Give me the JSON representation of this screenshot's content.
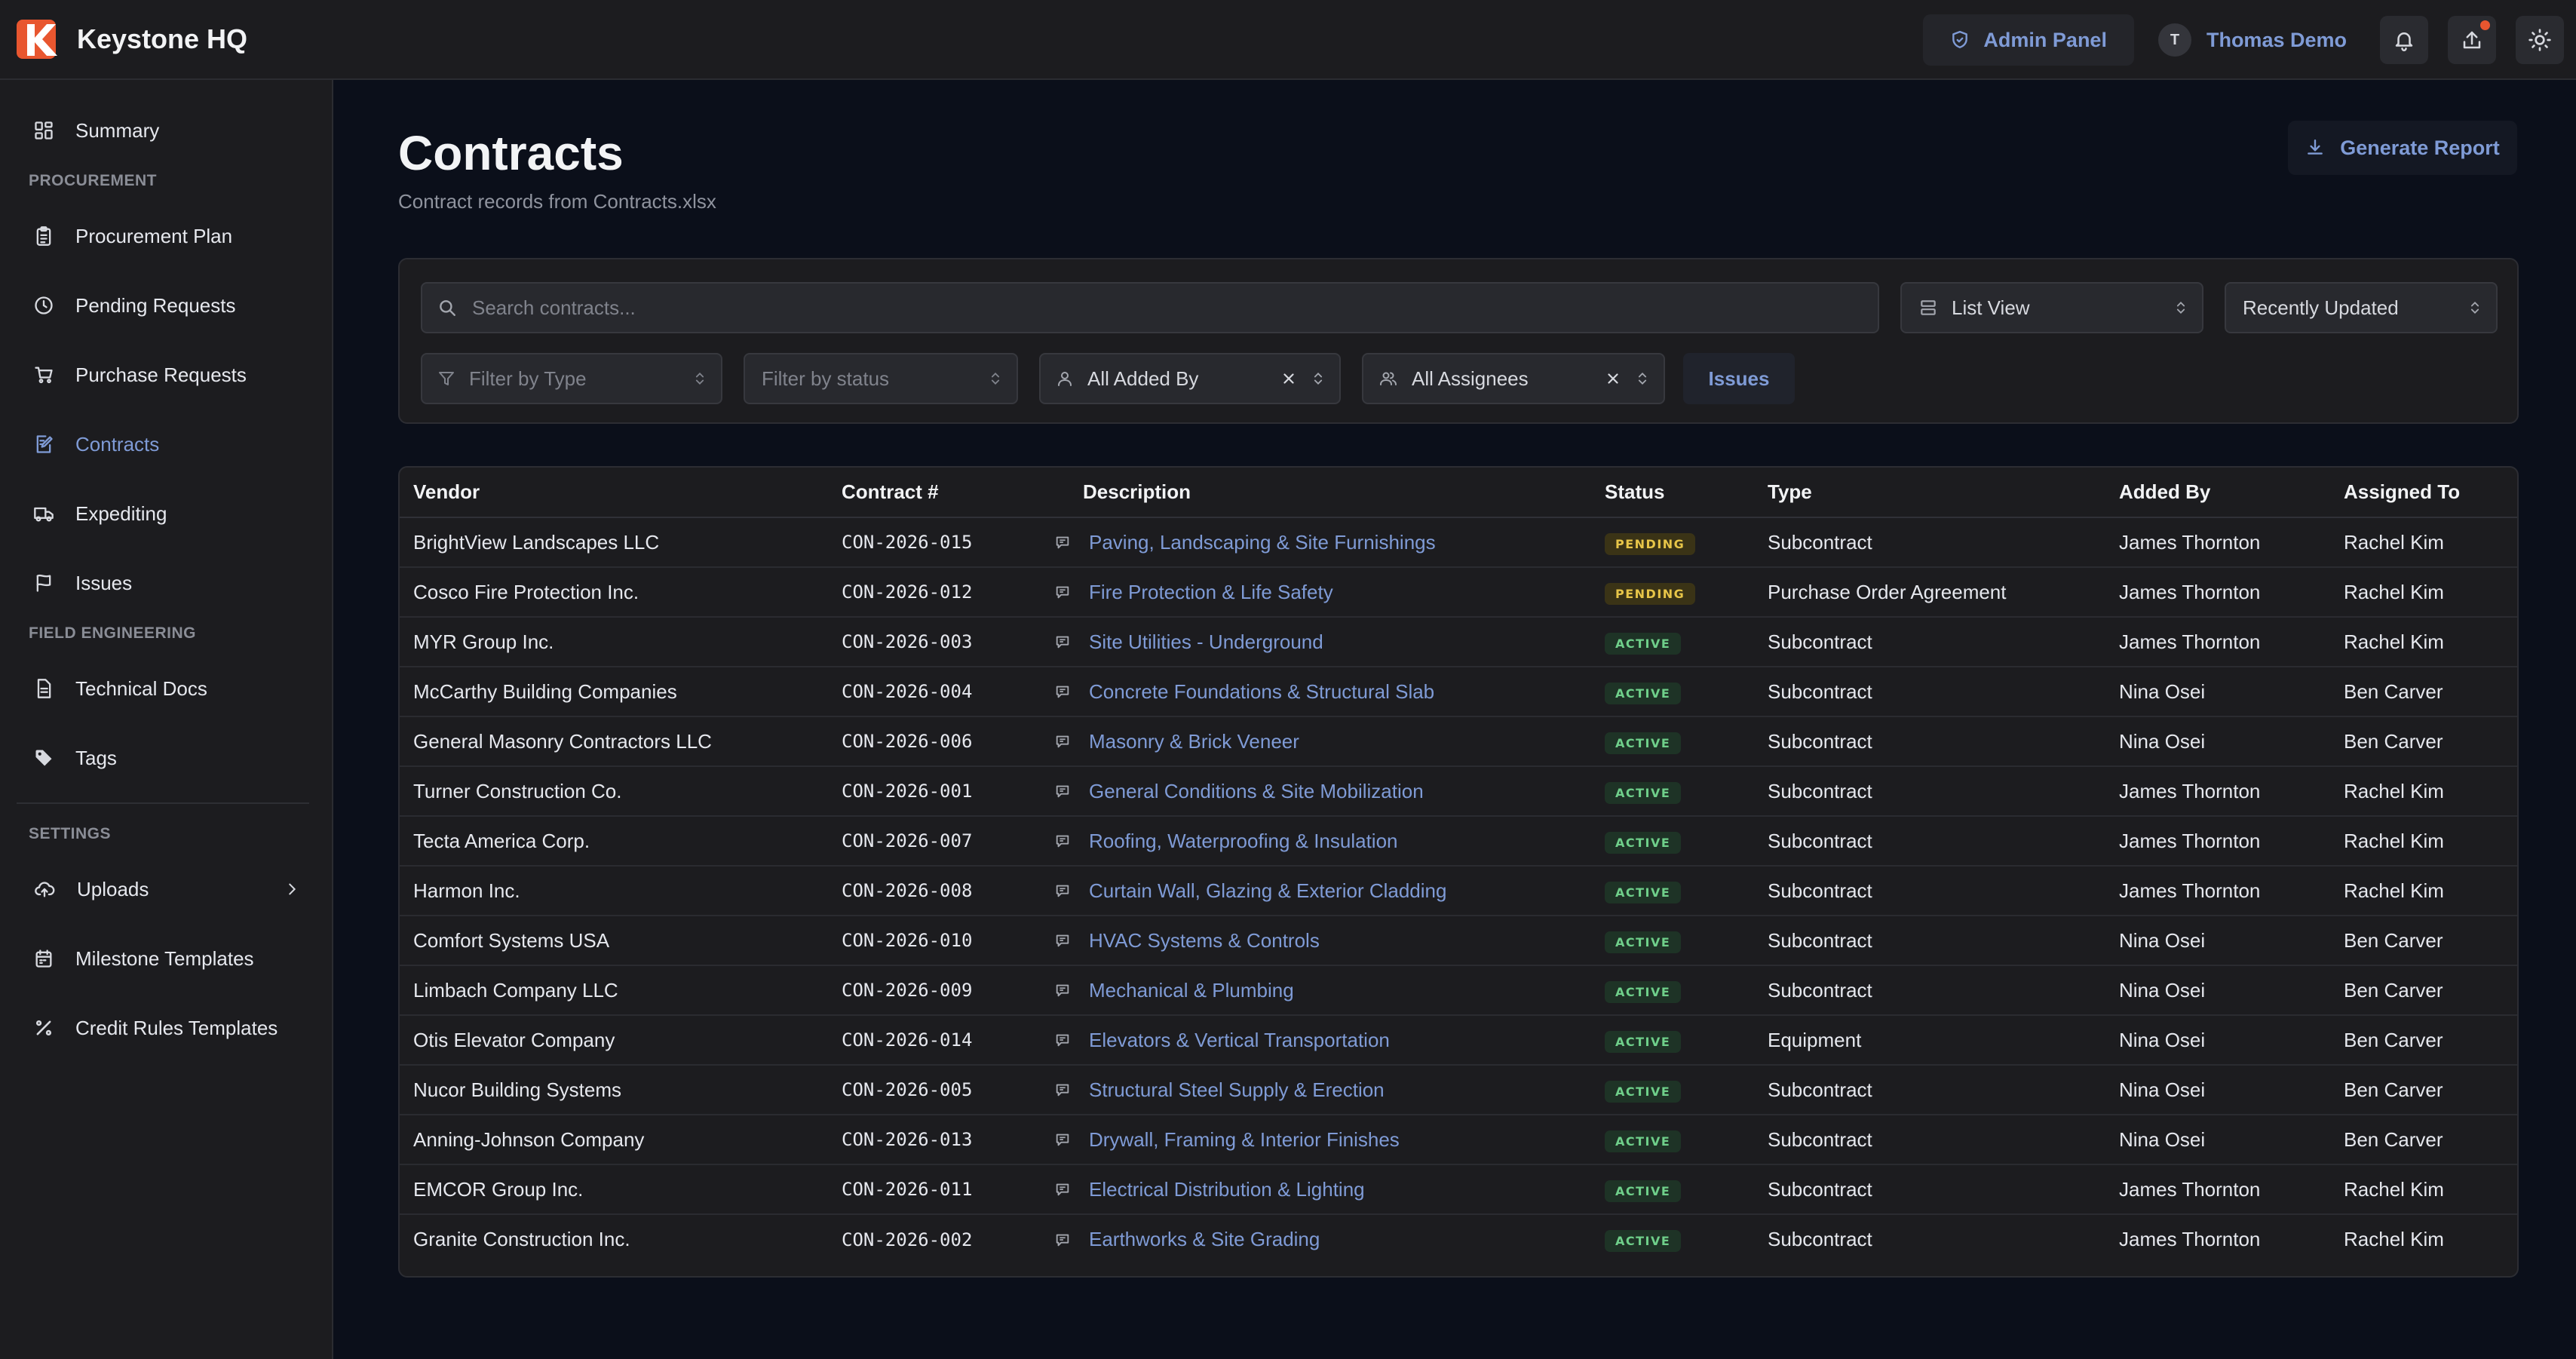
{
  "app": {
    "name": "Keystone HQ",
    "admin_panel_label": "Admin Panel",
    "user_initial": "T",
    "user_name": "Thomas Demo",
    "accent": "#7f9bd6",
    "logo_colors": [
      "#e8562f",
      "#ffffff"
    ]
  },
  "sidebar": {
    "summary": "Summary",
    "procurement_section": "PROCUREMENT",
    "procurement_plan": "Procurement Plan",
    "pending_requests": "Pending Requests",
    "purchase_requests": "Purchase Requests",
    "contracts": "Contracts",
    "expediting": "Expediting",
    "issues": "Issues",
    "field_engineering_section": "FIELD ENGINEERING",
    "technical_docs": "Technical Docs",
    "tags": "Tags",
    "settings_section": "SETTINGS",
    "uploads": "Uploads",
    "milestone_templates": "Milestone Templates",
    "credit_rules_templates": "Credit Rules Templates",
    "active_item": "Contracts"
  },
  "page": {
    "title": "Contracts",
    "subtitle": "Contract records from Contracts.xlsx",
    "generate_report": "Generate Report"
  },
  "filters": {
    "search_placeholder": "Search contracts...",
    "view_select": "List View",
    "sort_select": "Recently Updated",
    "type_placeholder": "Filter by Type",
    "status_placeholder": "Filter by status",
    "added_by": "All Added By",
    "assignees": "All Assignees",
    "issues_button": "Issues"
  },
  "table": {
    "columns": [
      "Vendor",
      "Contract #",
      "Description",
      "Status",
      "Type",
      "Added By",
      "Assigned To"
    ],
    "rows": [
      {
        "vendor": "BrightView Landscapes LLC",
        "contract": "CON-2026-015",
        "description": "Paving, Landscaping & Site Furnishings",
        "status": "PENDING",
        "type": "Subcontract",
        "added_by": "James Thornton",
        "assigned_to": "Rachel Kim"
      },
      {
        "vendor": "Cosco Fire Protection Inc.",
        "contract": "CON-2026-012",
        "description": "Fire Protection & Life Safety",
        "status": "PENDING",
        "type": "Purchase Order Agreement",
        "added_by": "James Thornton",
        "assigned_to": "Rachel Kim"
      },
      {
        "vendor": "MYR Group Inc.",
        "contract": "CON-2026-003",
        "description": "Site Utilities - Underground",
        "status": "ACTIVE",
        "type": "Subcontract",
        "added_by": "James Thornton",
        "assigned_to": "Rachel Kim"
      },
      {
        "vendor": "McCarthy Building Companies",
        "contract": "CON-2026-004",
        "description": "Concrete Foundations & Structural Slab",
        "status": "ACTIVE",
        "type": "Subcontract",
        "added_by": "Nina Osei",
        "assigned_to": "Ben Carver"
      },
      {
        "vendor": "General Masonry Contractors LLC",
        "contract": "CON-2026-006",
        "description": "Masonry & Brick Veneer",
        "status": "ACTIVE",
        "type": "Subcontract",
        "added_by": "Nina Osei",
        "assigned_to": "Ben Carver"
      },
      {
        "vendor": "Turner Construction Co.",
        "contract": "CON-2026-001",
        "description": "General Conditions & Site Mobilization",
        "status": "ACTIVE",
        "type": "Subcontract",
        "added_by": "James Thornton",
        "assigned_to": "Rachel Kim"
      },
      {
        "vendor": "Tecta America Corp.",
        "contract": "CON-2026-007",
        "description": "Roofing, Waterproofing & Insulation",
        "status": "ACTIVE",
        "type": "Subcontract",
        "added_by": "James Thornton",
        "assigned_to": "Rachel Kim"
      },
      {
        "vendor": "Harmon Inc.",
        "contract": "CON-2026-008",
        "description": "Curtain Wall, Glazing & Exterior Cladding",
        "status": "ACTIVE",
        "type": "Subcontract",
        "added_by": "James Thornton",
        "assigned_to": "Rachel Kim"
      },
      {
        "vendor": "Comfort Systems USA",
        "contract": "CON-2026-010",
        "description": "HVAC Systems & Controls",
        "status": "ACTIVE",
        "type": "Subcontract",
        "added_by": "Nina Osei",
        "assigned_to": "Ben Carver"
      },
      {
        "vendor": "Limbach Company LLC",
        "contract": "CON-2026-009",
        "description": "Mechanical & Plumbing",
        "status": "ACTIVE",
        "type": "Subcontract",
        "added_by": "Nina Osei",
        "assigned_to": "Ben Carver"
      },
      {
        "vendor": "Otis Elevator Company",
        "contract": "CON-2026-014",
        "description": "Elevators & Vertical Transportation",
        "status": "ACTIVE",
        "type": "Equipment",
        "added_by": "Nina Osei",
        "assigned_to": "Ben Carver"
      },
      {
        "vendor": "Nucor Building Systems",
        "contract": "CON-2026-005",
        "description": "Structural Steel Supply & Erection",
        "status": "ACTIVE",
        "type": "Subcontract",
        "added_by": "Nina Osei",
        "assigned_to": "Ben Carver"
      },
      {
        "vendor": "Anning-Johnson Company",
        "contract": "CON-2026-013",
        "description": "Drywall, Framing & Interior Finishes",
        "status": "ACTIVE",
        "type": "Subcontract",
        "added_by": "Nina Osei",
        "assigned_to": "Ben Carver"
      },
      {
        "vendor": "EMCOR Group Inc.",
        "contract": "CON-2026-011",
        "description": "Electrical Distribution & Lighting",
        "status": "ACTIVE",
        "type": "Subcontract",
        "added_by": "James Thornton",
        "assigned_to": "Rachel Kim"
      },
      {
        "vendor": "Granite Construction Inc.",
        "contract": "CON-2026-002",
        "description": "Earthworks & Site Grading",
        "status": "ACTIVE",
        "type": "Subcontract",
        "added_by": "James Thornton",
        "assigned_to": "Rachel Kim"
      }
    ]
  },
  "icons": {
    "topbar": [
      "shield-icon",
      "bell-icon",
      "upload-icon",
      "sun-icon"
    ],
    "sidebar": [
      "grid-icon",
      "clipboard-icon",
      "clock-icon",
      "cart-icon",
      "contract-icon",
      "truck-icon",
      "flag-icon",
      "document-icon",
      "tag-icon",
      "cloud-upload-icon",
      "calendar-icon",
      "percent-icon"
    ],
    "filters": [
      "search-icon",
      "list-icon",
      "filter-icon",
      "user-icon",
      "users-icon"
    ]
  }
}
